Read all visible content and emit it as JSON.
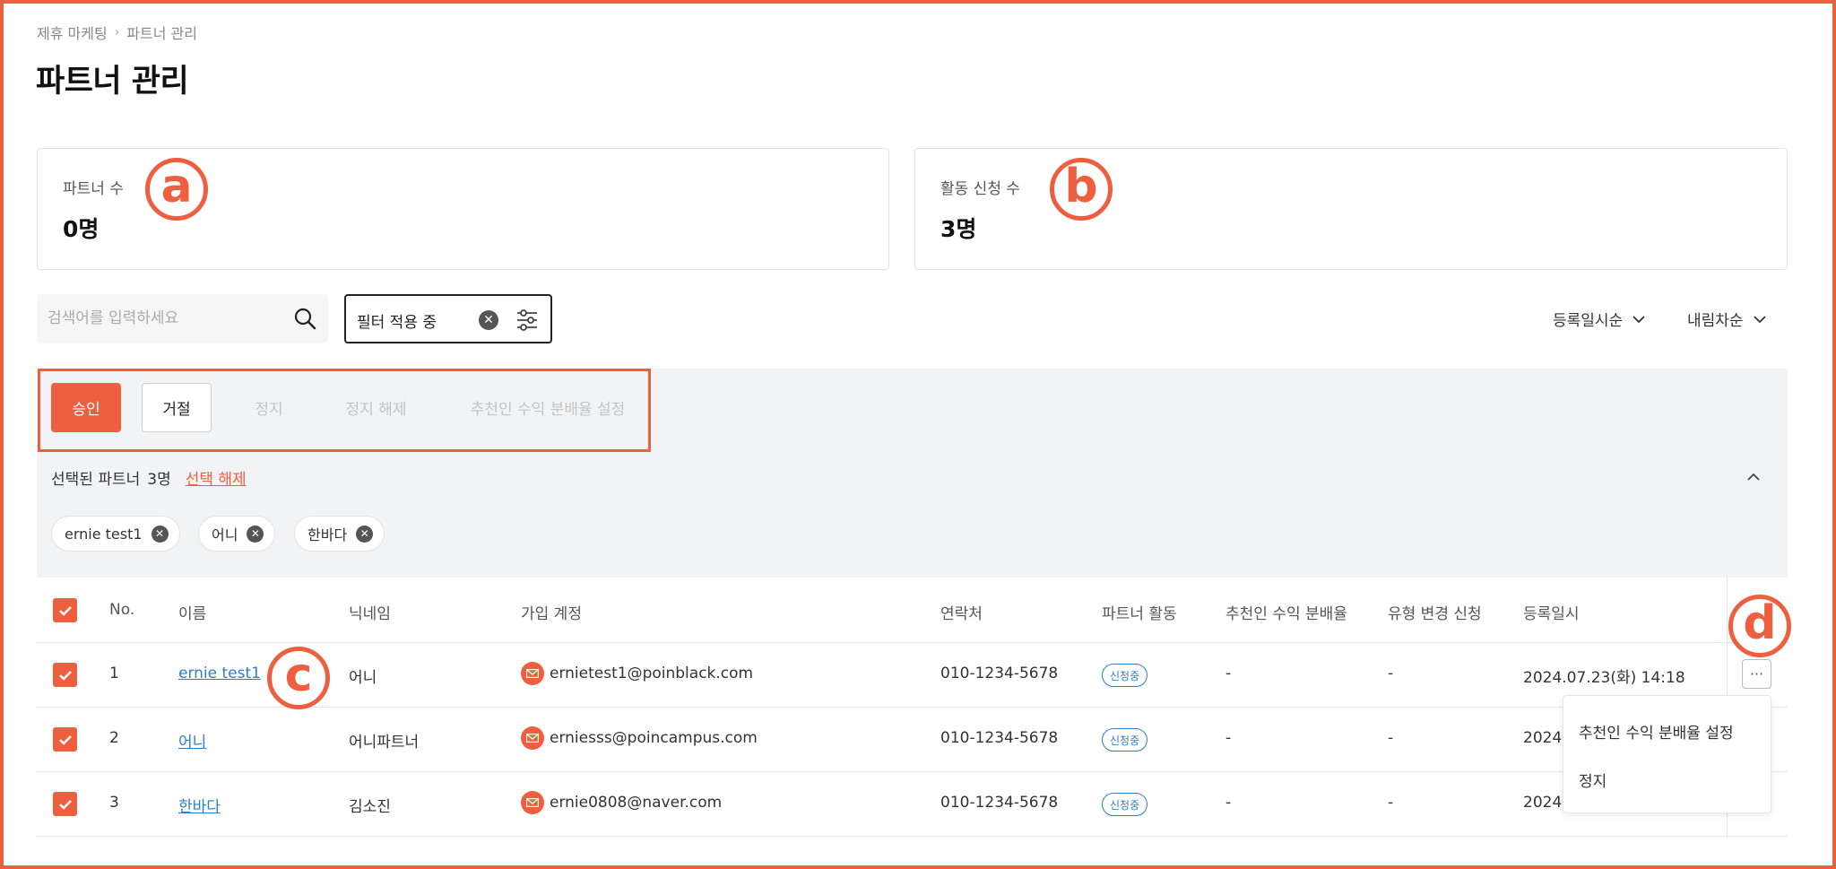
{
  "breadcrumb": {
    "parent": "제휴 마케팅",
    "separator": "›",
    "current": "파트너 관리"
  },
  "page_title": "파트너 관리",
  "stats": {
    "partners": {
      "label": "파트너 수",
      "value": "0명"
    },
    "applications": {
      "label": "활동 신청 수",
      "value": "3명"
    }
  },
  "callouts": {
    "a": "a",
    "b": "b",
    "c": "c",
    "d": "d"
  },
  "search": {
    "placeholder": "검색어를 입력하세요",
    "icon": "search-icon"
  },
  "filter": {
    "label": "필터 적용 중",
    "clear_glyph": "✕"
  },
  "sort": {
    "by": "등록일시순",
    "order": "내림차순"
  },
  "actions": {
    "approve": "승인",
    "reject": "거절",
    "suspend": "정지",
    "unsuspend": "정지 해제",
    "share_setting": "추천인 수익 분배율 설정"
  },
  "selection": {
    "label": "선택된 파트너",
    "count": "3명",
    "clear": "선택 해제",
    "chips": [
      "ernie test1",
      "어니",
      "한바다"
    ]
  },
  "table": {
    "headers": {
      "no": "No.",
      "name": "이름",
      "nickname": "닉네임",
      "account": "가입 계정",
      "phone": "연락처",
      "activity": "파트너 활동",
      "share": "추천인 수익 분배율",
      "type_change": "유형 변경 신청",
      "date": "등록일시"
    },
    "rows": [
      {
        "no": "1",
        "name": "ernie test1",
        "nickname": "어니",
        "account": "ernietest1@poinblack.com",
        "phone": "010-1234-5678",
        "activity": "신청중",
        "share": "-",
        "type_change": "-",
        "date": "2024.07.23(화) 14:18"
      },
      {
        "no": "2",
        "name": "어니",
        "nickname": "어니파트너",
        "account": "erniesss@poincampus.com",
        "phone": "010-1234-5678",
        "activity": "신청중",
        "share": "-",
        "type_change": "-",
        "date": "2024"
      },
      {
        "no": "3",
        "name": "한바다",
        "nickname": "김소진",
        "account": "ernie0808@naver.com",
        "phone": "010-1234-5678",
        "activity": "신청중",
        "share": "-",
        "type_change": "-",
        "date": "2024"
      }
    ]
  },
  "row_menu": {
    "more_glyph": "···",
    "items": [
      "추천인 수익 분배율 설정",
      "정지"
    ]
  },
  "colors": {
    "accent": "#ee5f3f",
    "link": "#2f7ec7"
  }
}
